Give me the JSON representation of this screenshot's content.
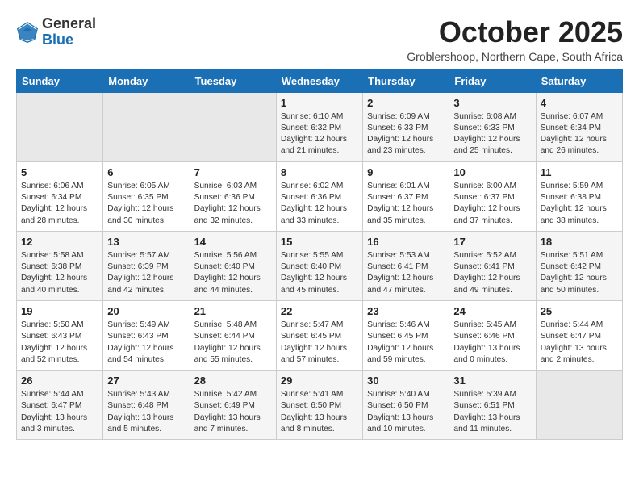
{
  "logo": {
    "general": "General",
    "blue": "Blue"
  },
  "title": "October 2025",
  "subtitle": "Groblershoop, Northern Cape, South Africa",
  "days_header": [
    "Sunday",
    "Monday",
    "Tuesday",
    "Wednesday",
    "Thursday",
    "Friday",
    "Saturday"
  ],
  "weeks": [
    [
      {
        "day": "",
        "content": ""
      },
      {
        "day": "",
        "content": ""
      },
      {
        "day": "",
        "content": ""
      },
      {
        "day": "1",
        "content": "Sunrise: 6:10 AM\nSunset: 6:32 PM\nDaylight: 12 hours\nand 21 minutes."
      },
      {
        "day": "2",
        "content": "Sunrise: 6:09 AM\nSunset: 6:33 PM\nDaylight: 12 hours\nand 23 minutes."
      },
      {
        "day": "3",
        "content": "Sunrise: 6:08 AM\nSunset: 6:33 PM\nDaylight: 12 hours\nand 25 minutes."
      },
      {
        "day": "4",
        "content": "Sunrise: 6:07 AM\nSunset: 6:34 PM\nDaylight: 12 hours\nand 26 minutes."
      }
    ],
    [
      {
        "day": "5",
        "content": "Sunrise: 6:06 AM\nSunset: 6:34 PM\nDaylight: 12 hours\nand 28 minutes."
      },
      {
        "day": "6",
        "content": "Sunrise: 6:05 AM\nSunset: 6:35 PM\nDaylight: 12 hours\nand 30 minutes."
      },
      {
        "day": "7",
        "content": "Sunrise: 6:03 AM\nSunset: 6:36 PM\nDaylight: 12 hours\nand 32 minutes."
      },
      {
        "day": "8",
        "content": "Sunrise: 6:02 AM\nSunset: 6:36 PM\nDaylight: 12 hours\nand 33 minutes."
      },
      {
        "day": "9",
        "content": "Sunrise: 6:01 AM\nSunset: 6:37 PM\nDaylight: 12 hours\nand 35 minutes."
      },
      {
        "day": "10",
        "content": "Sunrise: 6:00 AM\nSunset: 6:37 PM\nDaylight: 12 hours\nand 37 minutes."
      },
      {
        "day": "11",
        "content": "Sunrise: 5:59 AM\nSunset: 6:38 PM\nDaylight: 12 hours\nand 38 minutes."
      }
    ],
    [
      {
        "day": "12",
        "content": "Sunrise: 5:58 AM\nSunset: 6:38 PM\nDaylight: 12 hours\nand 40 minutes."
      },
      {
        "day": "13",
        "content": "Sunrise: 5:57 AM\nSunset: 6:39 PM\nDaylight: 12 hours\nand 42 minutes."
      },
      {
        "day": "14",
        "content": "Sunrise: 5:56 AM\nSunset: 6:40 PM\nDaylight: 12 hours\nand 44 minutes."
      },
      {
        "day": "15",
        "content": "Sunrise: 5:55 AM\nSunset: 6:40 PM\nDaylight: 12 hours\nand 45 minutes."
      },
      {
        "day": "16",
        "content": "Sunrise: 5:53 AM\nSunset: 6:41 PM\nDaylight: 12 hours\nand 47 minutes."
      },
      {
        "day": "17",
        "content": "Sunrise: 5:52 AM\nSunset: 6:41 PM\nDaylight: 12 hours\nand 49 minutes."
      },
      {
        "day": "18",
        "content": "Sunrise: 5:51 AM\nSunset: 6:42 PM\nDaylight: 12 hours\nand 50 minutes."
      }
    ],
    [
      {
        "day": "19",
        "content": "Sunrise: 5:50 AM\nSunset: 6:43 PM\nDaylight: 12 hours\nand 52 minutes."
      },
      {
        "day": "20",
        "content": "Sunrise: 5:49 AM\nSunset: 6:43 PM\nDaylight: 12 hours\nand 54 minutes."
      },
      {
        "day": "21",
        "content": "Sunrise: 5:48 AM\nSunset: 6:44 PM\nDaylight: 12 hours\nand 55 minutes."
      },
      {
        "day": "22",
        "content": "Sunrise: 5:47 AM\nSunset: 6:45 PM\nDaylight: 12 hours\nand 57 minutes."
      },
      {
        "day": "23",
        "content": "Sunrise: 5:46 AM\nSunset: 6:45 PM\nDaylight: 12 hours\nand 59 minutes."
      },
      {
        "day": "24",
        "content": "Sunrise: 5:45 AM\nSunset: 6:46 PM\nDaylight: 13 hours\nand 0 minutes."
      },
      {
        "day": "25",
        "content": "Sunrise: 5:44 AM\nSunset: 6:47 PM\nDaylight: 13 hours\nand 2 minutes."
      }
    ],
    [
      {
        "day": "26",
        "content": "Sunrise: 5:44 AM\nSunset: 6:47 PM\nDaylight: 13 hours\nand 3 minutes."
      },
      {
        "day": "27",
        "content": "Sunrise: 5:43 AM\nSunset: 6:48 PM\nDaylight: 13 hours\nand 5 minutes."
      },
      {
        "day": "28",
        "content": "Sunrise: 5:42 AM\nSunset: 6:49 PM\nDaylight: 13 hours\nand 7 minutes."
      },
      {
        "day": "29",
        "content": "Sunrise: 5:41 AM\nSunset: 6:50 PM\nDaylight: 13 hours\nand 8 minutes."
      },
      {
        "day": "30",
        "content": "Sunrise: 5:40 AM\nSunset: 6:50 PM\nDaylight: 13 hours\nand 10 minutes."
      },
      {
        "day": "31",
        "content": "Sunrise: 5:39 AM\nSunset: 6:51 PM\nDaylight: 13 hours\nand 11 minutes."
      },
      {
        "day": "",
        "content": ""
      }
    ]
  ]
}
